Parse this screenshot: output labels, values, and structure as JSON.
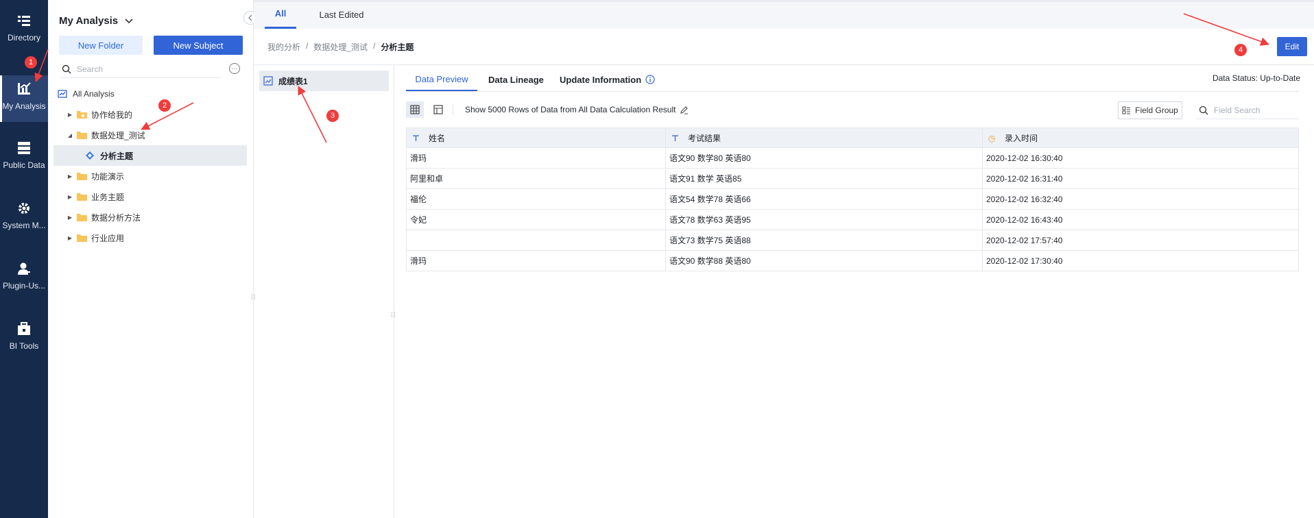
{
  "rail": {
    "items": [
      {
        "label": "Directory",
        "icon": "directory-icon"
      },
      {
        "label": "My Analysis",
        "icon": "analysis-chart-icon"
      },
      {
        "label": "Public Data",
        "icon": "database-icon"
      },
      {
        "label": "System M...",
        "icon": "gear-icon"
      },
      {
        "label": "Plugin-Us...",
        "icon": "user-icon"
      },
      {
        "label": "BI Tools",
        "icon": "toolbox-icon"
      }
    ]
  },
  "tree": {
    "title": "My Analysis",
    "new_folder": "New Folder",
    "new_subject": "New Subject",
    "search_placeholder": "Search",
    "root": "All Analysis",
    "items": [
      {
        "label": "协作给我的"
      },
      {
        "label": "数据处理_测试"
      },
      {
        "label": "分析主题"
      },
      {
        "label": "功能演示"
      },
      {
        "label": "业务主题"
      },
      {
        "label": "数据分析方法"
      },
      {
        "label": "行业应用"
      }
    ]
  },
  "topbar": {
    "tabs": [
      "All",
      "Last Edited"
    ]
  },
  "breadcrumb": {
    "items": [
      "我的分析",
      "数据处理_测试",
      "分析主题"
    ],
    "sep": "/"
  },
  "edit_label": "Edit",
  "tablelist": {
    "item": "成绩表1"
  },
  "subtabs": [
    "Data Preview",
    "Data Lineage",
    "Update Information"
  ],
  "data_status": "Data Status: Up-to-Date",
  "toolbar": {
    "rows_info": "Show 5000 Rows of Data from All Data Calculation Result",
    "field_group": "Field Group",
    "field_search_placeholder": "Field Search"
  },
  "grid": {
    "columns": [
      "姓名",
      "考试结果",
      "录入时间"
    ],
    "rows": [
      [
        "滑玛",
        "语文90 数学80 英语80",
        "2020-12-02 16:30:40"
      ],
      [
        "阿里和卓",
        "语文91 数学 英语85",
        "2020-12-02 16:31:40"
      ],
      [
        "福伦",
        "语文54 数学78 英语66",
        "2020-12-02 16:32:40"
      ],
      [
        "令妃",
        "语文78 数学63 英语95",
        "2020-12-02 16:43:40"
      ],
      [
        "",
        "语文73 数学75 英语88",
        "2020-12-02 17:57:40"
      ],
      [
        "滑玛",
        "语文90 数学88 英语80",
        "2020-12-02 17:30:40"
      ]
    ]
  },
  "annotations": {
    "badges": [
      "1",
      "2",
      "3",
      "4"
    ],
    "color": "#f03c3c"
  }
}
